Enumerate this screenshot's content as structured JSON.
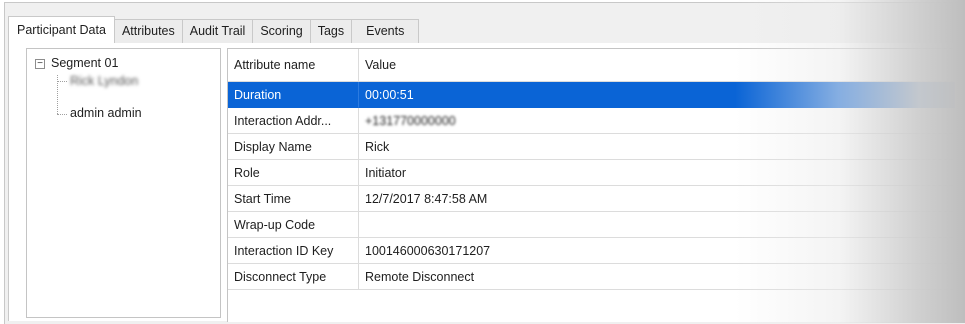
{
  "tabs": [
    {
      "label": "Participant Data",
      "active": true
    },
    {
      "label": "Attributes",
      "active": false
    },
    {
      "label": "Audit Trail",
      "active": false
    },
    {
      "label": "Scoring",
      "active": false
    },
    {
      "label": "Tags",
      "active": false
    },
    {
      "label": "Events",
      "active": false
    }
  ],
  "tree": {
    "root": {
      "label": "Segment 01",
      "expander": "minus-icon"
    },
    "children": [
      {
        "label": "Rick Lyndon",
        "redacted": true
      },
      {
        "label": "admin admin",
        "redacted": false
      }
    ]
  },
  "grid": {
    "columns": [
      "Attribute name",
      "Value"
    ],
    "rows": [
      {
        "name": "Duration",
        "value": "00:00:51",
        "selected": true
      },
      {
        "name": "Interaction Addr...",
        "value": "+131770000000",
        "value_redacted": true
      },
      {
        "name": "Display Name",
        "value": "Rick"
      },
      {
        "name": "Role",
        "value": "Initiator"
      },
      {
        "name": "Start Time",
        "value": "12/7/2017 8:47:58 AM"
      },
      {
        "name": "Wrap-up Code",
        "value": ""
      },
      {
        "name": "Interaction ID Key",
        "value": "100146000630171207"
      },
      {
        "name": "Disconnect Type",
        "value": "Remote Disconnect"
      }
    ]
  },
  "colors": {
    "selection": "#0A64D6",
    "panel_bg": "#F0F0F0",
    "grid_line": "#DCDCDC"
  }
}
